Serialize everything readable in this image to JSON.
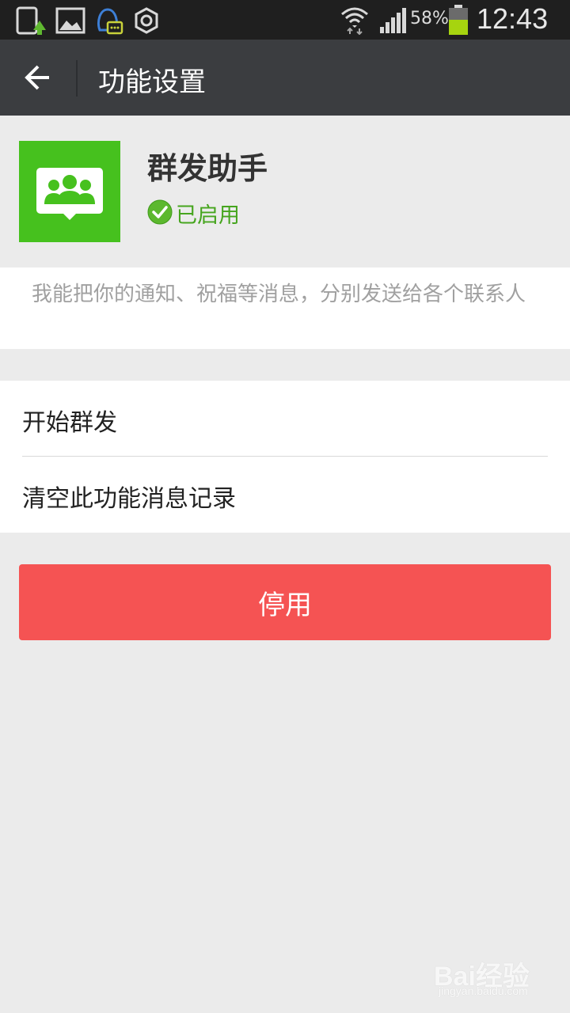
{
  "status_bar": {
    "battery_percent": "58%",
    "battery_level": 0.58,
    "clock": "12:43",
    "icons": [
      "upload-notification-icon",
      "gallery-icon",
      "qq-message-icon",
      "settings-hex-icon",
      "wifi-icon",
      "signal-icon",
      "battery-icon"
    ]
  },
  "title_bar": {
    "title": "功能设置",
    "back_icon": "back-arrow-icon"
  },
  "feature": {
    "name": "群发助手",
    "status": "已启用",
    "icon": "group-chat-icon",
    "status_icon": "check-circle-icon"
  },
  "description": {
    "text": "我能把你的通知、祝福等消息，分别发送给各个联系人"
  },
  "menu": {
    "items": [
      {
        "label": "开始群发"
      },
      {
        "label": "清空此功能消息记录"
      }
    ]
  },
  "actions": {
    "disable_label": "停用"
  },
  "watermark": {
    "brand": "Bai经验",
    "url": "jingyan.baidu.com"
  },
  "colors": {
    "accent_green": "#46c11e",
    "danger_red": "#f55353",
    "titlebar": "#3b3d40",
    "background": "#ebebeb"
  }
}
